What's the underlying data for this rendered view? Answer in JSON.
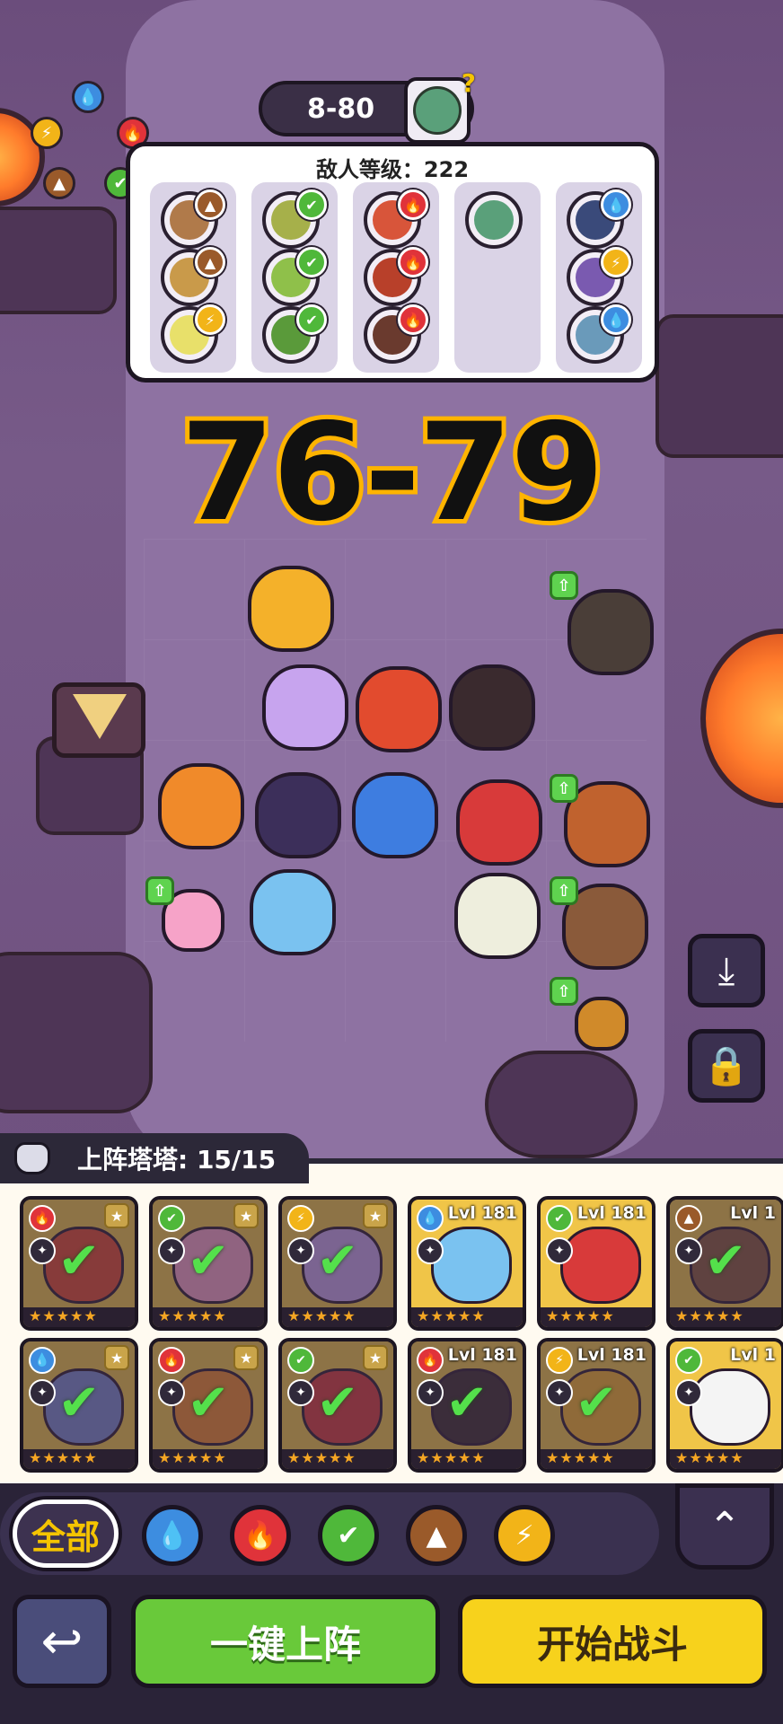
{
  "stage": {
    "label": "8-80"
  },
  "enemy_panel": {
    "title": "敌人等级：222",
    "columns": [
      {
        "enemies": [
          {
            "element": "earth"
          },
          {
            "element": "earth"
          },
          {
            "element": "electric"
          }
        ]
      },
      {
        "enemies": [
          {
            "element": "grass"
          },
          {
            "element": "grass"
          },
          {
            "element": "grass"
          }
        ]
      },
      {
        "enemies": [
          {
            "element": "fire"
          },
          {
            "element": "fire"
          },
          {
            "element": "fire"
          }
        ]
      },
      {
        "enemies": [
          {
            "element": "none"
          }
        ]
      },
      {
        "enemies": [
          {
            "element": "water"
          },
          {
            "element": "electric"
          },
          {
            "element": "water"
          }
        ]
      }
    ]
  },
  "overlay_text": "76-79",
  "roster": {
    "label": "上阵塔塔: 15/15",
    "cards": [
      {
        "element": "fire",
        "level": "",
        "checked": true
      },
      {
        "element": "grass",
        "level": "",
        "checked": true
      },
      {
        "element": "electric",
        "level": "",
        "checked": true
      },
      {
        "element": "water",
        "level": "Lvl 181",
        "checked": false
      },
      {
        "element": "grass",
        "level": "Lvl 181",
        "checked": false
      },
      {
        "element": "earth",
        "level": "Lvl 1",
        "checked": true
      },
      {
        "element": "water",
        "level": "",
        "checked": true
      },
      {
        "element": "fire",
        "level": "",
        "checked": true
      },
      {
        "element": "grass",
        "level": "",
        "checked": true
      },
      {
        "element": "fire",
        "level": "Lvl 181",
        "checked": true
      },
      {
        "element": "electric",
        "level": "Lvl 181",
        "checked": true
      },
      {
        "element": "grass",
        "level": "Lvl 1",
        "checked": false
      }
    ]
  },
  "filters": {
    "all_label": "全部",
    "elements": [
      "water-icon",
      "fire-icon",
      "grass-icon",
      "earth-icon",
      "electric-icon"
    ]
  },
  "buttons": {
    "deploy_label": "一键上阵",
    "start_label": "开始战斗"
  },
  "colors": {
    "water": "#3d8de0",
    "fire": "#e0333a",
    "grass": "#4fb83a",
    "earth": "#9a5a2a",
    "electric": "#f2b418",
    "none": "#888888",
    "accent_yellow": "#f7d21c",
    "accent_green": "#69c93a"
  }
}
